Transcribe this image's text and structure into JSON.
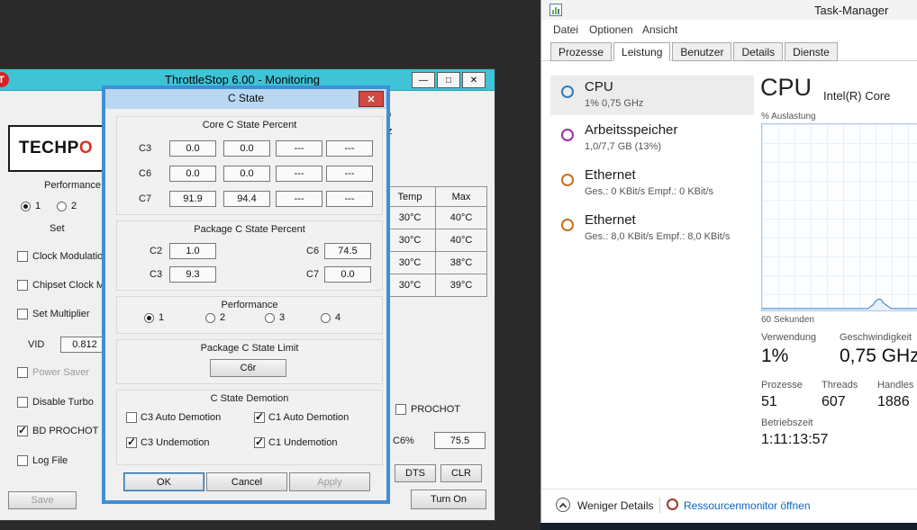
{
  "throttlestop": {
    "window_title": "ThrottleStop 6.00 - Monitoring",
    "window_icon_letter": "T",
    "window_buttons": {
      "minimize": "—",
      "maximize": "□",
      "close": "✕"
    },
    "logo": {
      "black": "TECHP",
      "red": "O"
    },
    "performance_heading": "Performance",
    "profile_radios": [
      {
        "label": "1",
        "selected": true
      },
      {
        "label": "2",
        "selected": false
      }
    ],
    "set_heading": "Set",
    "left_checks": [
      {
        "label": "Clock Modulation",
        "checked": false,
        "disabled": false
      },
      {
        "label": "Chipset Clock Mod",
        "checked": false,
        "disabled": false
      },
      {
        "label": "Set Multiplier",
        "checked": false,
        "disabled": false
      },
      {
        "label": "Power Saver",
        "checked": false,
        "disabled": true
      },
      {
        "label": "Disable Turbo",
        "checked": false,
        "disabled": false
      },
      {
        "label": "BD PROCHOT",
        "checked": true,
        "disabled": false
      },
      {
        "label": "Log File",
        "checked": false,
        "disabled": false
      }
    ],
    "vid": {
      "label": "VID",
      "value": "0.812"
    },
    "save_label": "Save",
    "fragments": {
      "top": "0",
      "bottom": "z"
    },
    "temp_table": {
      "headers": [
        "Temp",
        "Max"
      ],
      "rows": [
        [
          "30°C",
          "40°C"
        ],
        [
          "30°C",
          "40°C"
        ],
        [
          "30°C",
          "38°C"
        ],
        [
          "30°C",
          "39°C"
        ]
      ]
    },
    "prochot": {
      "label": "PROCHOT",
      "checked": false
    },
    "c6": {
      "label": "C6%",
      "value": "75.5"
    },
    "dts_label": "DTS",
    "clr_label": "CLR",
    "turn_on_label": "Turn On"
  },
  "cstate": {
    "title": "C State",
    "close_glyph": "✕",
    "core": {
      "title": "Core C State Percent",
      "rows": [
        {
          "label": "C3",
          "v": [
            "0.0",
            "0.0",
            "---",
            "---"
          ]
        },
        {
          "label": "C6",
          "v": [
            "0.0",
            "0.0",
            "---",
            "---"
          ]
        },
        {
          "label": "C7",
          "v": [
            "91.9",
            "94.4",
            "---",
            "---"
          ]
        }
      ]
    },
    "package": {
      "title": "Package C State Percent",
      "rows": [
        {
          "l1": "C2",
          "v1": "1.0",
          "l2": "C6",
          "v2": "74.5"
        },
        {
          "l1": "C3",
          "v1": "9.3",
          "l2": "C7",
          "v2": "0.0"
        }
      ]
    },
    "performance": {
      "title": "Performance",
      "radios": [
        {
          "label": "1",
          "selected": true
        },
        {
          "label": "2",
          "selected": false
        },
        {
          "label": "3",
          "selected": false
        },
        {
          "label": "4",
          "selected": false
        }
      ]
    },
    "limit": {
      "title": "Package C State Limit",
      "button_label": "C6r"
    },
    "demotion": {
      "title": "C State Demotion",
      "checks": [
        {
          "label": "C3 Auto Demotion",
          "checked": false
        },
        {
          "label": "C1 Auto Demotion",
          "checked": true
        },
        {
          "label": "C3 Undemotion",
          "checked": true
        },
        {
          "label": "C1 Undemotion",
          "checked": true
        }
      ]
    },
    "ok_label": "OK",
    "cancel_label": "Cancel",
    "apply_label": "Apply"
  },
  "taskmanager": {
    "title": "Task-Manager",
    "menu": [
      "Datei",
      "Optionen",
      "Ansicht"
    ],
    "tabs": [
      {
        "label": "Prozesse",
        "active": false
      },
      {
        "label": "Leistung",
        "active": true
      },
      {
        "label": "Benutzer",
        "active": false
      },
      {
        "label": "Details",
        "active": false
      },
      {
        "label": "Dienste",
        "active": false
      }
    ],
    "sidebar": [
      {
        "name": "CPU",
        "detail": "1% 0,75 GHz",
        "ring_color": "#2f7cc0",
        "selected": true
      },
      {
        "name": "Arbeitsspeicher",
        "detail": "1,0/7,7 GB (13%)",
        "ring_color": "#9b30a8",
        "selected": false
      },
      {
        "name": "Ethernet",
        "detail": "Ges.: 0 KBit/s Empf.: 0 KBit/s",
        "ring_color": "#c4711c",
        "selected": false
      },
      {
        "name": "Ethernet",
        "detail": "Ges.: 8,0 KBit/s Empf.: 8,0 KBit/s",
        "ring_color": "#c4711c",
        "selected": false
      }
    ],
    "cpu_panel": {
      "title": "CPU",
      "chip": "Intel(R) Core",
      "graph_ylabel": "% Auslastung",
      "graph_xlabel": "60 Sekunden",
      "graph_points_pct": [
        1,
        1,
        1,
        1,
        1,
        1,
        1,
        1,
        1,
        1,
        1,
        1,
        1,
        1,
        1,
        1,
        1,
        1,
        1,
        1,
        1,
        1,
        1,
        1,
        1,
        1,
        1,
        1,
        1,
        1,
        1,
        1,
        1,
        1,
        1,
        1,
        1,
        1,
        1,
        1,
        1,
        1,
        2,
        3,
        5,
        6,
        6,
        4,
        3,
        2,
        1,
        1,
        1,
        1,
        1,
        1,
        1,
        1,
        1,
        1,
        1
      ],
      "stats": [
        {
          "label": "Verwendung",
          "value": "1%"
        },
        {
          "label": "Geschwindigkeit",
          "value": "0,75 GHz"
        },
        {
          "label": "Prozesse",
          "value": "51"
        },
        {
          "label": "Threads",
          "value": "607"
        },
        {
          "label": "Handles",
          "value": "1886"
        },
        {
          "label": "Betriebszeit",
          "value": "1:11:13:57"
        }
      ]
    },
    "footer": {
      "collapse_label": "Weniger Details",
      "resmon_label": "Ressourcenmonitor öffnen"
    }
  }
}
